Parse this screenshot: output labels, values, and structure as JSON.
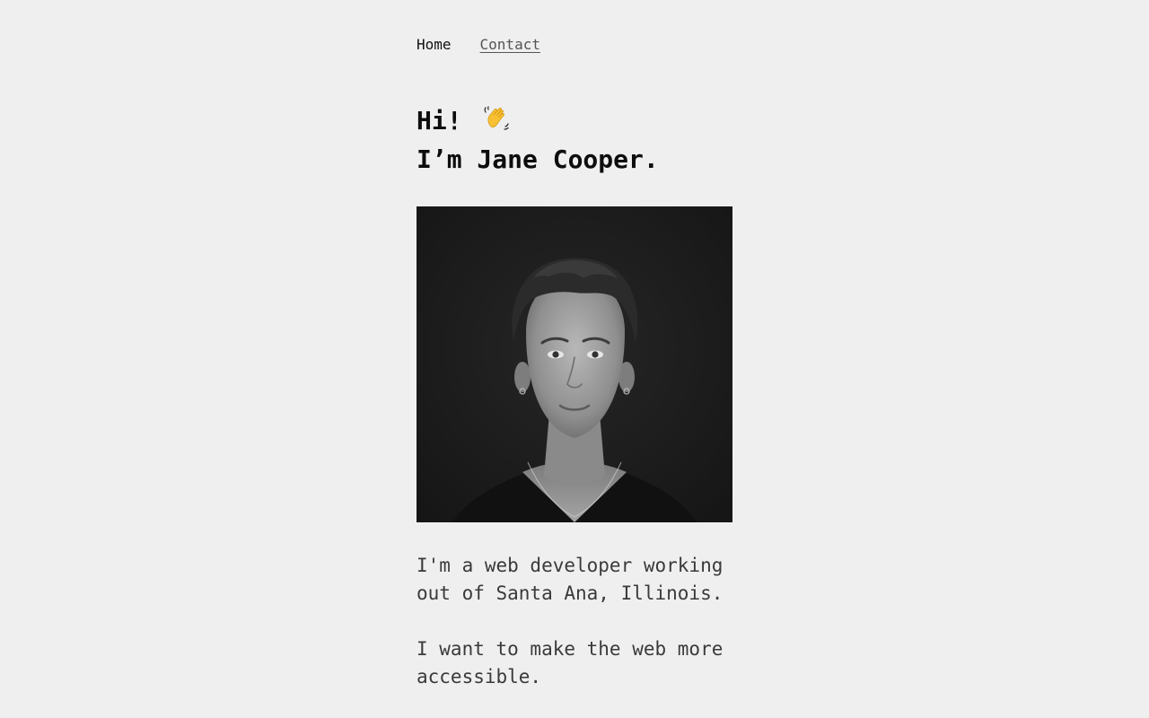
{
  "nav": {
    "home_label": "Home",
    "contact_label": "Contact"
  },
  "hero": {
    "greeting": "Hi!",
    "wave_icon": "waving-hand-icon",
    "name_line": "I’m Jane Cooper."
  },
  "photo": {
    "subject": "portrait-photo"
  },
  "bio": {
    "paragraph_1": "I'm a web developer working out of Santa Ana, Illinois.",
    "paragraph_2": "I want to make the web more accessible."
  },
  "colors": {
    "background": "#efefef",
    "text": "#111111",
    "muted_text": "#3a3a3a",
    "photo_bg": "#1c1c1c"
  }
}
